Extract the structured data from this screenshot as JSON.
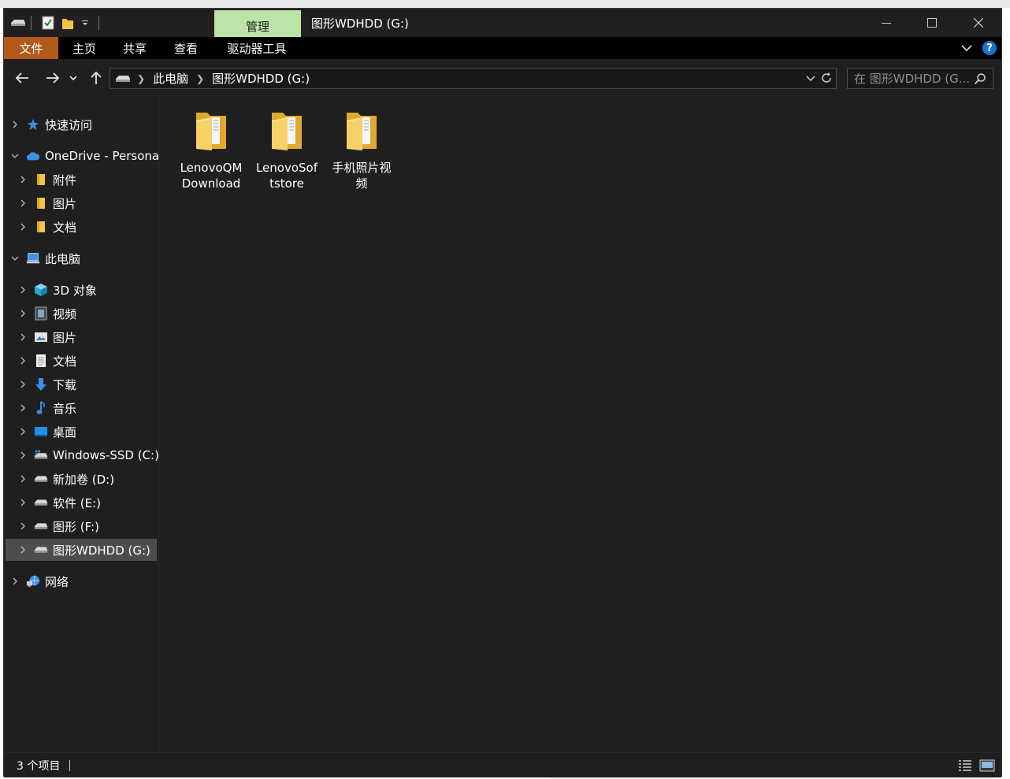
{
  "window": {
    "manage_tab": "管理",
    "title": "图形WDHDD (G:)"
  },
  "ribbon": {
    "tabs": [
      "文件",
      "主页",
      "共享",
      "查看",
      "驱动器工具"
    ]
  },
  "address": {
    "crumbs": [
      "此电脑",
      "图形WDHDD (G:)"
    ],
    "search_placeholder": "在 图形WDHDD (G..."
  },
  "sidebar": {
    "quick_access": "快速访问",
    "onedrive": "OneDrive - Persona",
    "onedrive_children": [
      "附件",
      "图片",
      "文档"
    ],
    "this_pc": "此电脑",
    "pc_children": [
      "3D 对象",
      "视频",
      "图片",
      "文档",
      "下载",
      "音乐",
      "桌面",
      "Windows-SSD (C:)",
      "新加卷 (D:)",
      "软件 (E:)",
      "图形 (F:)",
      "图形WDHDD (G:)"
    ],
    "network": "网络"
  },
  "content": {
    "folders": [
      "LenovoQMDownload",
      "LenovoSoftstore",
      "手机照片视频"
    ]
  },
  "status": {
    "item_count": "3 个项目"
  },
  "colors": {
    "background": "#1f1f1f",
    "ribbon": "#000000",
    "file_tab": "#b35a1a",
    "manage_tab": "#bde4a8",
    "selected": "#4d4d4d",
    "help": "#1e6fd6",
    "folder": "#f4c542"
  },
  "icons": {
    "quick_access": "star-icon",
    "onedrive": "cloud-icon",
    "folder": "folder-icon",
    "this_pc": "computer-icon",
    "network": "network-icon"
  }
}
